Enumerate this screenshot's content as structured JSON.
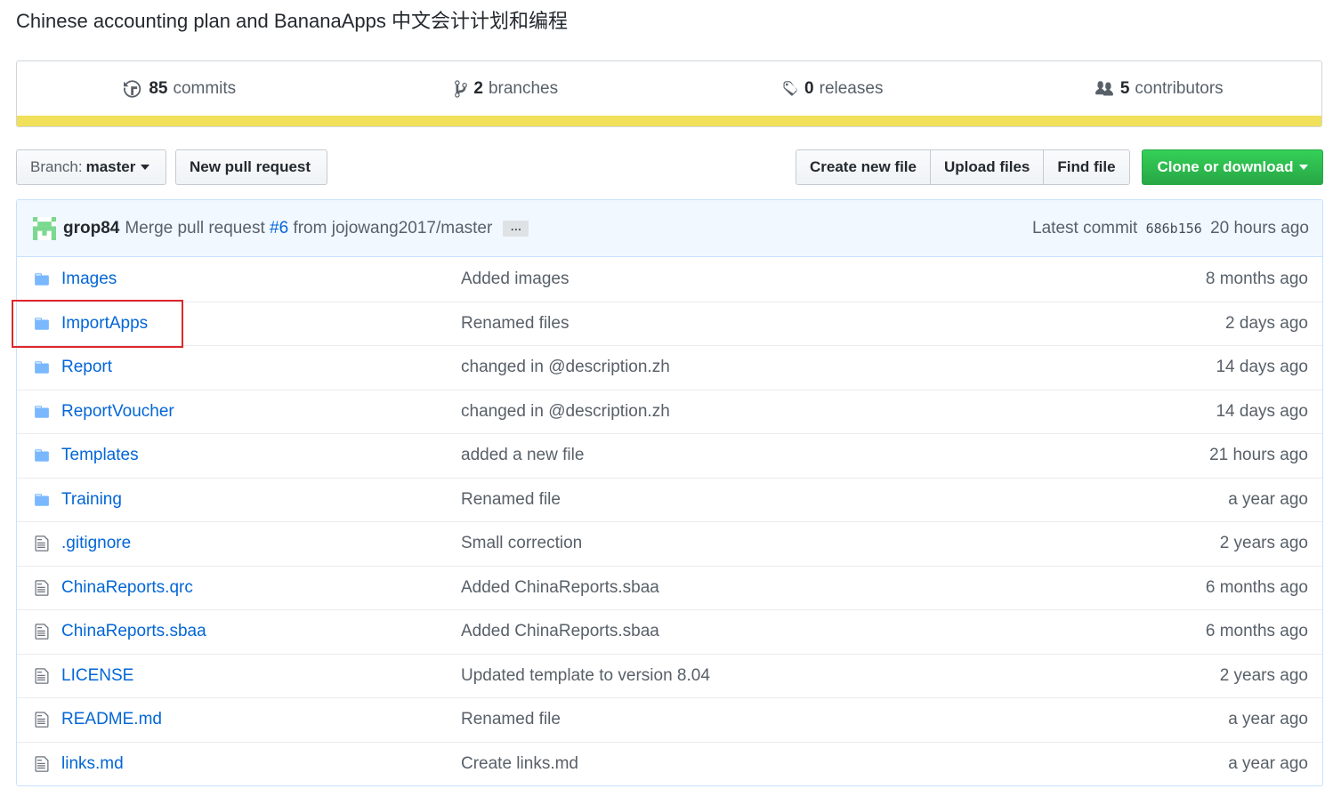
{
  "repo": {
    "description": "Chinese accounting plan and BananaApps 中文会计计划和编程"
  },
  "summary": {
    "commits": {
      "count": "85",
      "label": "commits"
    },
    "branches": {
      "count": "2",
      "label": "branches"
    },
    "releases": {
      "count": "0",
      "label": "releases"
    },
    "contributors": {
      "count": "5",
      "label": "contributors"
    },
    "language_color": "#f1e05a"
  },
  "toolbar": {
    "branch_prefix": "Branch:",
    "branch_name": "master",
    "new_pull_request": "New pull request",
    "create_new_file": "Create new file",
    "upload_files": "Upload files",
    "find_file": "Find file",
    "clone_or_download": "Clone or download"
  },
  "latest_commit": {
    "author": "grop84",
    "message_prefix": "Merge pull request",
    "pr_link": "#6",
    "message_suffix": "from jojowang2017/master",
    "ellipsis": "…",
    "latest_label": "Latest commit",
    "sha": "686b156",
    "age": "20 hours ago"
  },
  "files": [
    {
      "type": "folder",
      "name": "Images",
      "message": "Added images",
      "age": "8 months ago"
    },
    {
      "type": "folder",
      "name": "ImportApps",
      "message": "Renamed files",
      "age": "2 days ago"
    },
    {
      "type": "folder",
      "name": "Report",
      "message": "changed in @description.zh",
      "age": "14 days ago"
    },
    {
      "type": "folder",
      "name": "ReportVoucher",
      "message": "changed in @description.zh",
      "age": "14 days ago"
    },
    {
      "type": "folder",
      "name": "Templates",
      "message": "added a new file",
      "age": "21 hours ago"
    },
    {
      "type": "folder",
      "name": "Training",
      "message": "Renamed file",
      "age": "a year ago"
    },
    {
      "type": "file",
      "name": ".gitignore",
      "message": "Small correction",
      "age": "2 years ago"
    },
    {
      "type": "file",
      "name": "ChinaReports.qrc",
      "message": "Added ChinaReports.sbaa",
      "age": "6 months ago"
    },
    {
      "type": "file",
      "name": "ChinaReports.sbaa",
      "message": "Added ChinaReports.sbaa",
      "age": "6 months ago"
    },
    {
      "type": "file",
      "name": "LICENSE",
      "message": "Updated template to version 8.04",
      "age": "2 years ago"
    },
    {
      "type": "file",
      "name": "README.md",
      "message": "Renamed file",
      "age": "a year ago"
    },
    {
      "type": "file",
      "name": "links.md",
      "message": "Create links.md",
      "age": "a year ago"
    }
  ],
  "colors": {
    "link": "#0366d6",
    "folder_icon": "#79b8ff",
    "file_icon": "#6a737d",
    "highlight": "#e0262b",
    "primary_button": "#28a745"
  }
}
